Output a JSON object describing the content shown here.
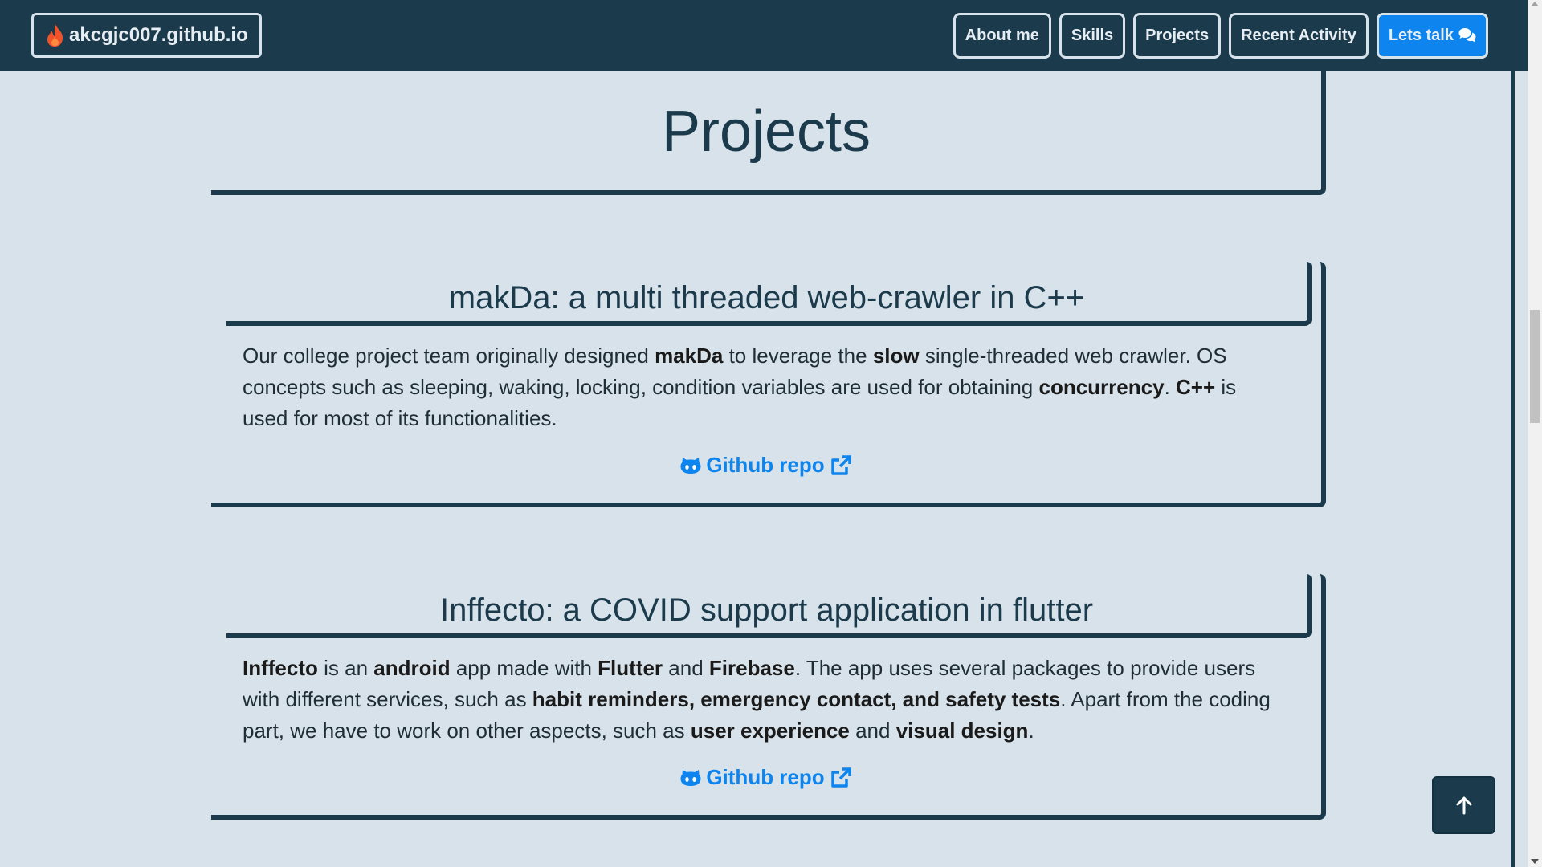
{
  "nav": {
    "brand": "akcgjc007.github.io",
    "brand_icon": "flame-icon",
    "links": [
      "About me",
      "Skills",
      "Projects",
      "Recent Activity"
    ],
    "cta_label": "Lets talk",
    "cta_icon": "comments-icon"
  },
  "page": {
    "heading": "Projects"
  },
  "projects": [
    {
      "title": "makDa: a multi threaded web-crawler in C++",
      "segments": [
        {
          "t": "Our college project team originally designed ",
          "b": false
        },
        {
          "t": "makDa",
          "b": true
        },
        {
          "t": " to leverage the ",
          "b": false
        },
        {
          "t": "slow",
          "b": true
        },
        {
          "t": " single-threaded web crawler. OS concepts such as sleeping, waking, locking, condition variables are used for obtaining ",
          "b": false
        },
        {
          "t": "concurrency",
          "b": true
        },
        {
          "t": ". ",
          "b": false
        },
        {
          "t": "C++",
          "b": true
        },
        {
          "t": " is used for most of its functionalities.",
          "b": false
        }
      ],
      "link_label": "Github repo"
    },
    {
      "title": "Inffecto: a COVID support application in flutter",
      "segments": [
        {
          "t": "Inffecto",
          "b": true
        },
        {
          "t": " is an ",
          "b": false
        },
        {
          "t": "android",
          "b": true
        },
        {
          "t": " app made with ",
          "b": false
        },
        {
          "t": "Flutter",
          "b": true
        },
        {
          "t": " and ",
          "b": false
        },
        {
          "t": "Firebase",
          "b": true
        },
        {
          "t": ". The app uses several packages to provide users with different services, such as ",
          "b": false
        },
        {
          "t": "habit reminders, emergency contact, and safety tests",
          "b": true
        },
        {
          "t": ". Apart from the coding part, we have to work on other aspects, such as ",
          "b": false
        },
        {
          "t": "user experience",
          "b": true
        },
        {
          "t": " and ",
          "b": false
        },
        {
          "t": "visual design",
          "b": true
        },
        {
          "t": ".",
          "b": false
        }
      ],
      "link_label": "Github repo"
    }
  ],
  "colors": {
    "navy": "#1b3a4b",
    "background": "#d7e2ea",
    "accent": "#0d84ee",
    "flame": "#f1522b"
  },
  "icons": {
    "link_icon": "github-icon",
    "external_icon": "external-link-icon",
    "to_top_icon": "arrow-up-icon"
  }
}
